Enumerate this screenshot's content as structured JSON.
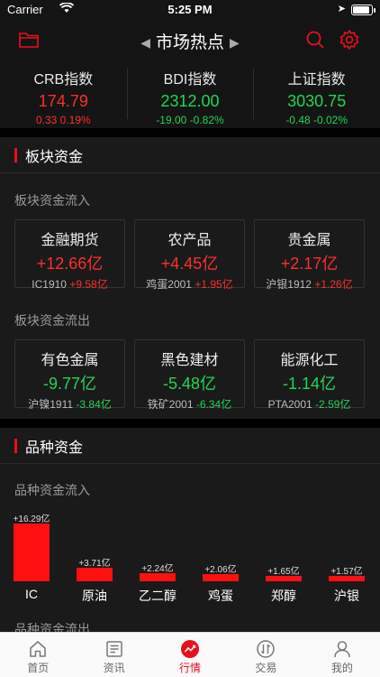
{
  "status_bar": {
    "carrier": "Carrier",
    "time": "5:25 PM"
  },
  "nav": {
    "title": "市场热点"
  },
  "indexes": [
    {
      "name": "CRB指数",
      "value": "174.79",
      "change": "0.33 0.19%",
      "trend": "up"
    },
    {
      "name": "BDI指数",
      "value": "2312.00",
      "change": "-19.00 -0.82%",
      "trend": "down"
    },
    {
      "name": "上证指数",
      "value": "3030.75",
      "change": "-0.48 -0.02%",
      "trend": "down"
    }
  ],
  "sector": {
    "title": "板块资金",
    "inflow_label": "板块资金流入",
    "inflow": [
      {
        "name": "金融期货",
        "value": "+12.66亿",
        "sub_name": "IC1910",
        "sub_value": "+9.58亿",
        "trend": "up"
      },
      {
        "name": "农产品",
        "value": "+4.45亿",
        "sub_name": "鸡蛋2001",
        "sub_value": "+1.95亿",
        "trend": "up"
      },
      {
        "name": "贵金属",
        "value": "+2.17亿",
        "sub_name": "沪银1912",
        "sub_value": "+1.26亿",
        "trend": "up"
      }
    ],
    "outflow_label": "板块资金流出",
    "outflow": [
      {
        "name": "有色金属",
        "value": "-9.77亿",
        "sub_name": "沪镍1911",
        "sub_value": "-3.84亿",
        "trend": "down"
      },
      {
        "name": "黑色建材",
        "value": "-5.48亿",
        "sub_name": "铁矿2001",
        "sub_value": "-6.34亿",
        "trend": "down"
      },
      {
        "name": "能源化工",
        "value": "-1.14亿",
        "sub_name": "PTA2001",
        "sub_value": "-2.59亿",
        "trend": "down"
      }
    ]
  },
  "variety": {
    "title": "品种资金",
    "inflow_label": "品种资金流入",
    "outflow_label": "品种资金流出"
  },
  "chart_data": {
    "type": "bar",
    "categories": [
      "IC",
      "原油",
      "乙二醇",
      "鸡蛋",
      "郑醇",
      "沪银"
    ],
    "values": [
      16.29,
      3.71,
      2.24,
      2.06,
      1.65,
      1.57
    ],
    "value_labels": [
      "+16.29亿",
      "+3.71亿",
      "+2.24亿",
      "+2.06亿",
      "+1.65亿",
      "+1.57亿"
    ],
    "color": "#ff1010"
  },
  "tabs": [
    {
      "label": "首页",
      "icon": "home-icon"
    },
    {
      "label": "资讯",
      "icon": "news-icon"
    },
    {
      "label": "行情",
      "icon": "market-icon",
      "active": true
    },
    {
      "label": "交易",
      "icon": "trade-icon"
    },
    {
      "label": "我的",
      "icon": "profile-icon"
    }
  ],
  "colors": {
    "up": "#ff2d2d",
    "down": "#1fd655",
    "accent": "#e8101c",
    "background": "#141414"
  }
}
